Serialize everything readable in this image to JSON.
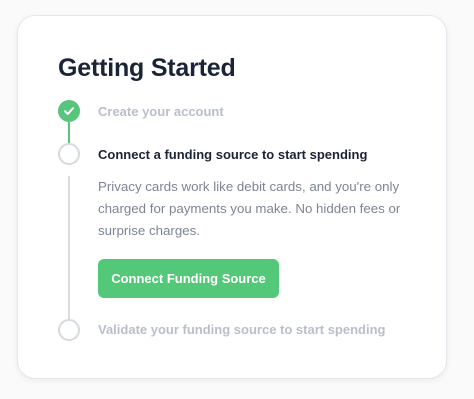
{
  "card": {
    "title": "Getting Started"
  },
  "steps": [
    {
      "label": "Create your account",
      "status": "complete",
      "icon": "check-icon"
    },
    {
      "label": "Connect a funding source to start spending",
      "status": "current",
      "description": "Privacy cards work like debit cards, and you're only charged for payments you make. No hidden fees or surprise charges.",
      "action_label": "Connect Funding Source"
    },
    {
      "label": "Validate your funding source to start spending",
      "status": "pending"
    }
  ],
  "colors": {
    "accent": "#52c878",
    "title": "#1b2437",
    "muted": "#b8bfca",
    "body": "#7c8594"
  }
}
